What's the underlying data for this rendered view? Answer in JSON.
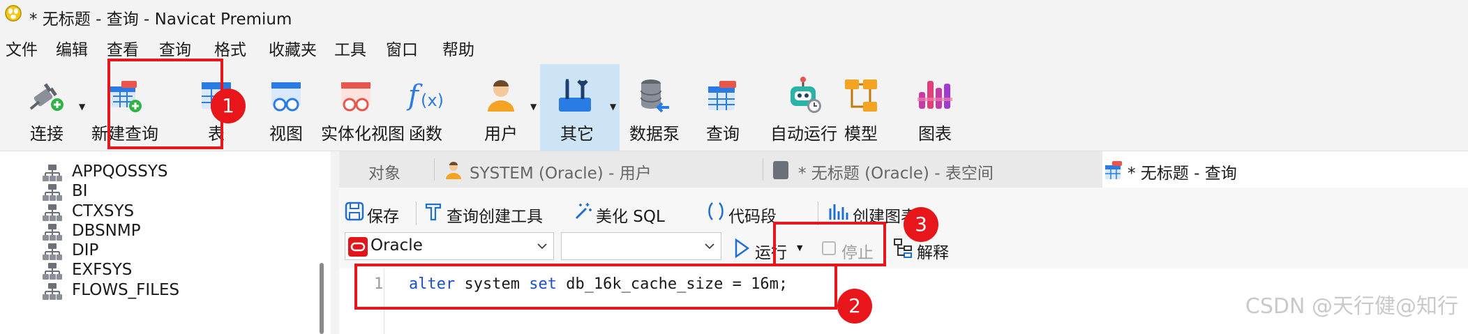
{
  "window": {
    "title": "* 无标题 - 查询 - Navicat Premium"
  },
  "menu": [
    "文件",
    "编辑",
    "查看",
    "查询",
    "格式",
    "收藏夹",
    "工具",
    "窗口",
    "帮助"
  ],
  "toolbar": {
    "items": [
      {
        "label": "连接",
        "icon": "connection-plug-icon",
        "dropdown": true
      },
      {
        "label": "新建查询",
        "icon": "new-query-icon"
      },
      {
        "label": "表",
        "icon": "table-icon"
      },
      {
        "label": "视图",
        "icon": "view-icon"
      },
      {
        "label": "实体化视图",
        "icon": "materialized-view-icon"
      },
      {
        "label": "函数",
        "icon": "function-icon"
      },
      {
        "label": "用户",
        "icon": "user-icon",
        "dropdown": true
      },
      {
        "label": "其它",
        "icon": "other-tools-icon",
        "dropdown": true,
        "active": true
      },
      {
        "label": "数据泵",
        "icon": "data-pump-icon"
      },
      {
        "label": "查询",
        "icon": "query-icon"
      },
      {
        "label": "自动运行",
        "icon": "automation-robot-icon"
      },
      {
        "label": "模型",
        "icon": "model-icon"
      },
      {
        "label": "图表",
        "icon": "chart-icon"
      }
    ]
  },
  "sidebar": {
    "schemas": [
      "APPQOSSYS",
      "BI",
      "CTXSYS",
      "DBSNMP",
      "DIP",
      "EXFSYS",
      "FLOWS_FILES"
    ]
  },
  "tabs": [
    {
      "label": "对象"
    },
    {
      "label": "SYSTEM (Oracle) - 用户",
      "icon": "user-icon"
    },
    {
      "label": "* 无标题 (Oracle) - 表空间",
      "icon": "tablespace-icon"
    },
    {
      "label": "* 无标题 - 查询",
      "icon": "query-icon",
      "active": true
    }
  ],
  "editor_toolbar": {
    "save": "保存",
    "query_builder": "查询创建工具",
    "beautify": "美化 SQL",
    "snippet": "代码段",
    "create_chart": "创建图表"
  },
  "run_bar": {
    "connection": "Oracle",
    "schema": "",
    "run": "运行",
    "stop": "停止",
    "explain": "解释"
  },
  "code": {
    "line_number": "1",
    "tokens": [
      {
        "text": "alter",
        "kw": true
      },
      {
        "text": " system ",
        "kw": false
      },
      {
        "text": "set",
        "kw": true
      },
      {
        "text": " db_16k_cache_size = 16m;",
        "kw": false
      }
    ]
  },
  "annotations": [
    "1",
    "2",
    "3"
  ],
  "watermark": "CSDN @天行健@知行",
  "colors": {
    "annotation_red": "#e8161b",
    "keyword_blue": "#1c4fcc",
    "active_tool": "#cde4f7"
  }
}
